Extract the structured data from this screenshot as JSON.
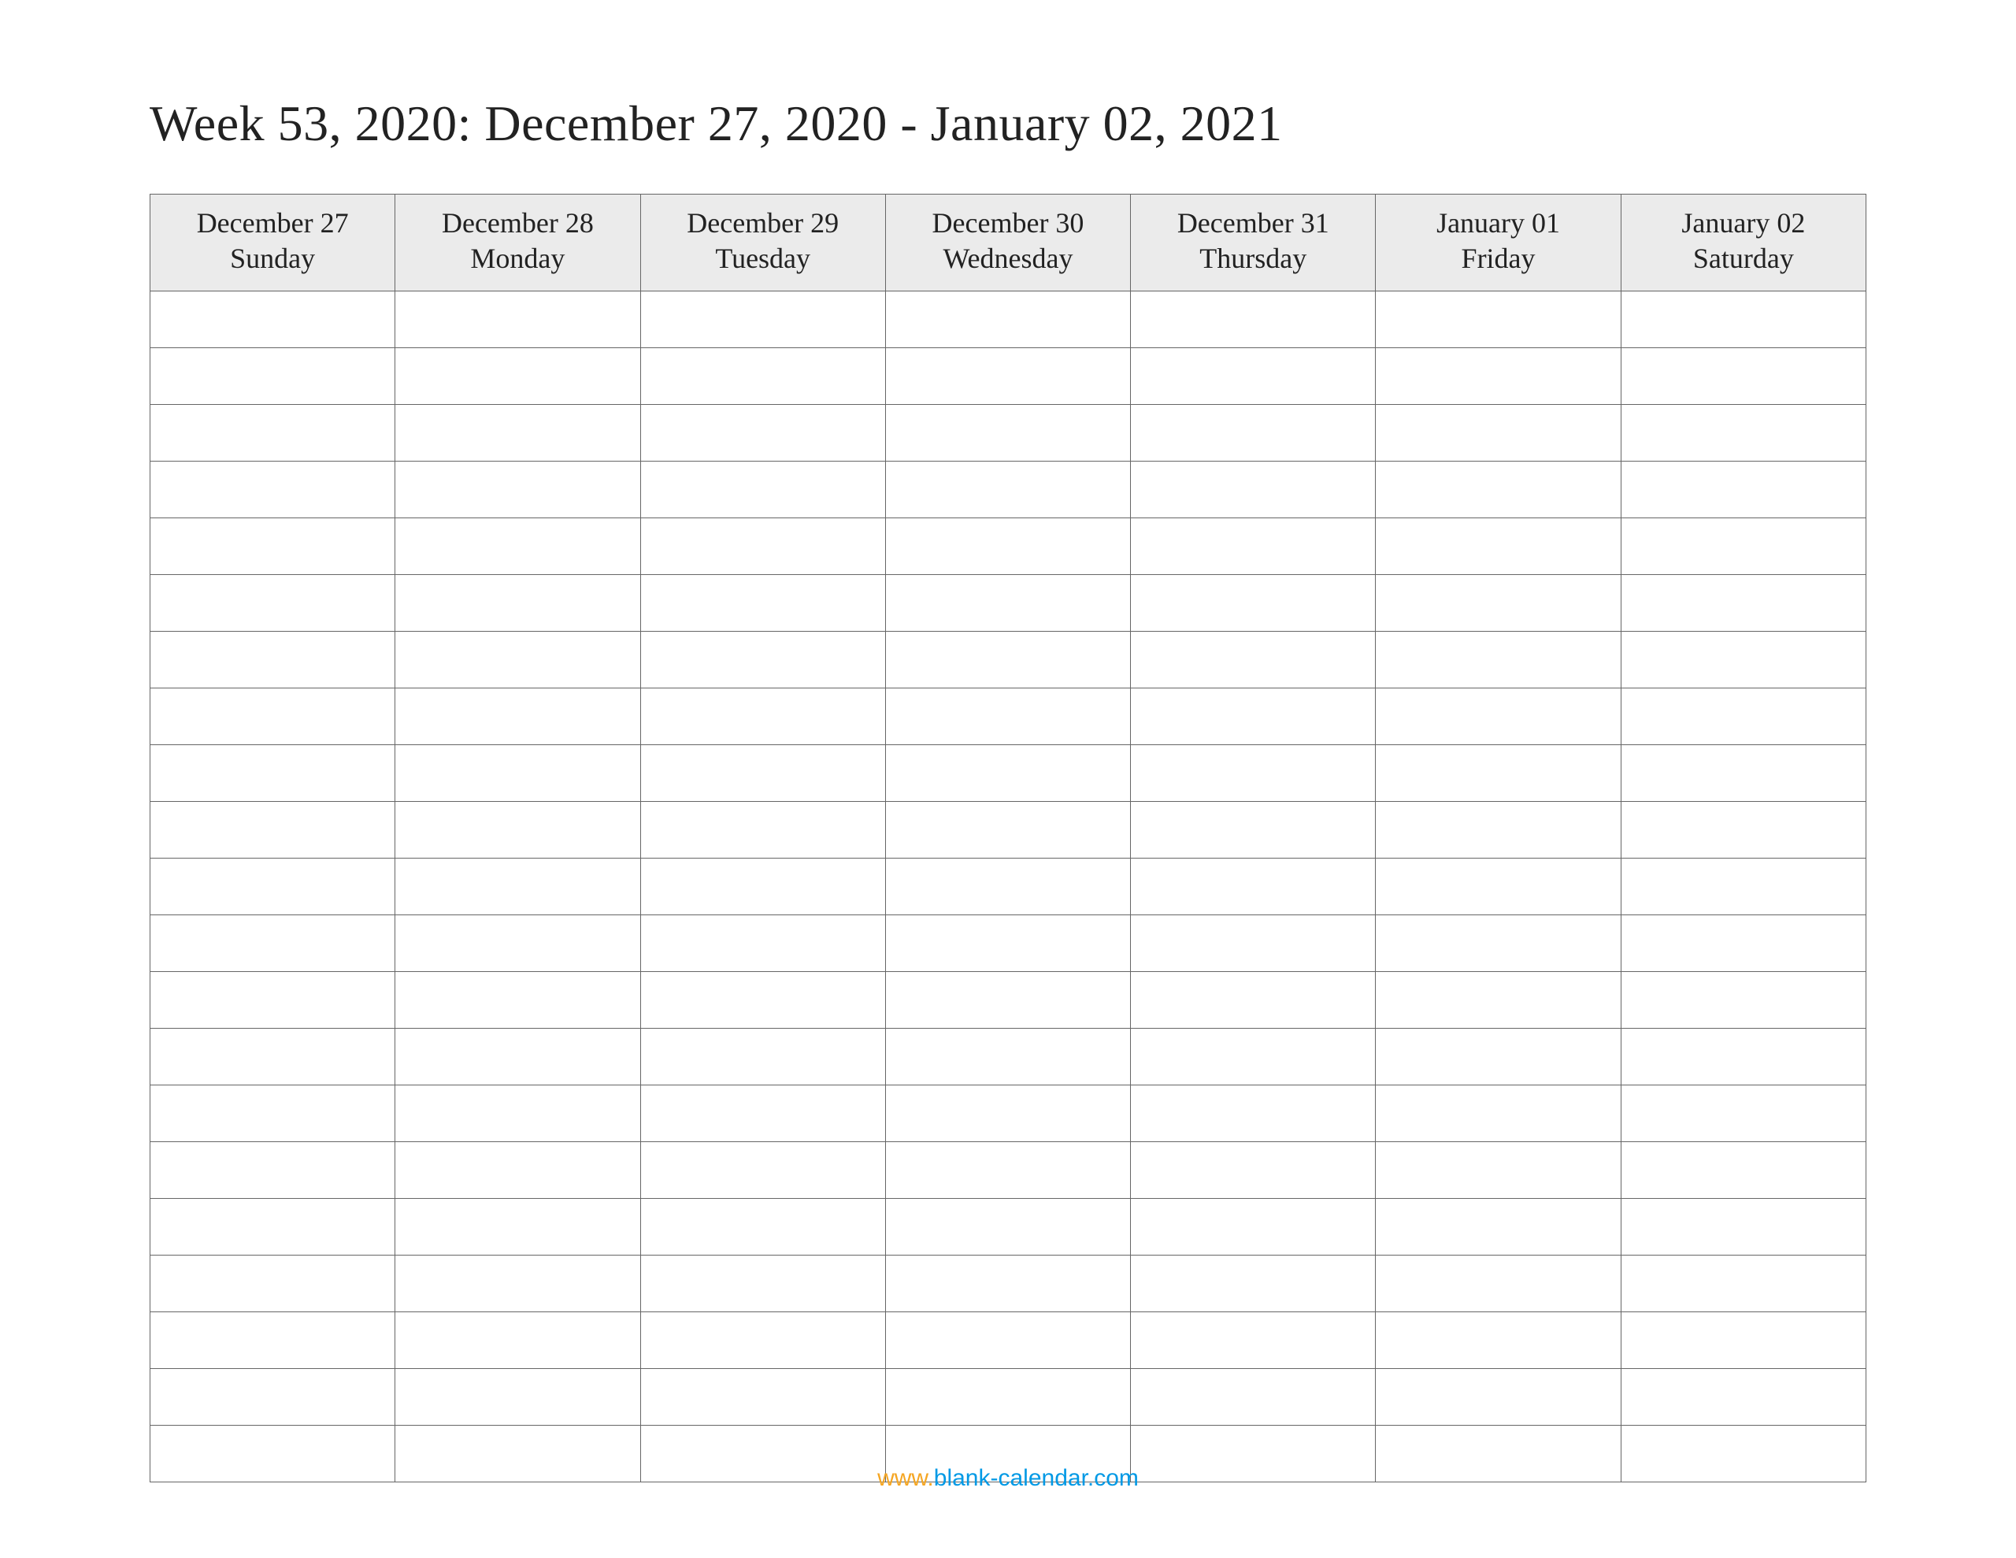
{
  "title": "Week 53, 2020: December 27, 2020 - January 02, 2021",
  "columns": [
    {
      "date": "December 27",
      "dow": "Sunday"
    },
    {
      "date": "December 28",
      "dow": "Monday"
    },
    {
      "date": "December 29",
      "dow": "Tuesday"
    },
    {
      "date": "December 30",
      "dow": "Wednesday"
    },
    {
      "date": "December 31",
      "dow": "Thursday"
    },
    {
      "date": "January 01",
      "dow": "Friday"
    },
    {
      "date": "January 02",
      "dow": "Saturday"
    }
  ],
  "row_count": 21,
  "footer": {
    "www": "www.",
    "domain": "blank-calendar.com"
  }
}
